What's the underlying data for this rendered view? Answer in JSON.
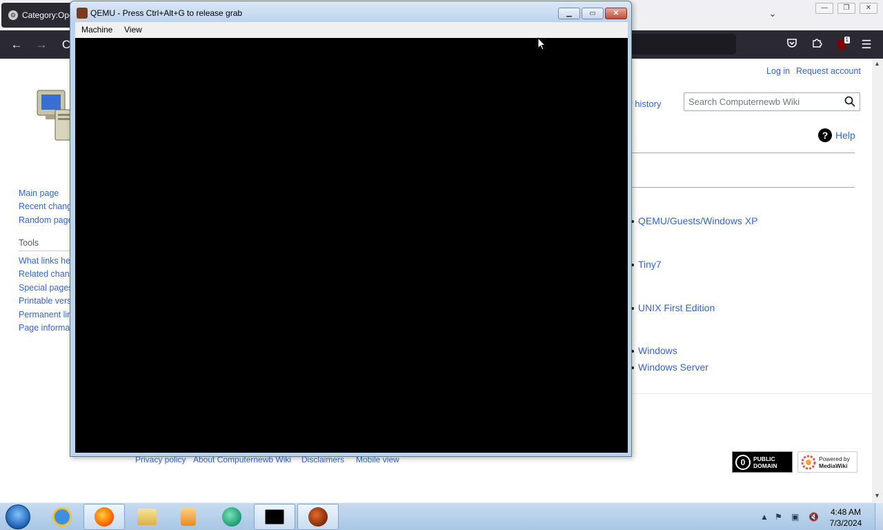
{
  "browser": {
    "tab_title": "Category:Operating",
    "window_controls": {
      "minimize": "—",
      "maximize": "❐",
      "close": "✕"
    },
    "nav": {
      "back": "←",
      "forward": "→",
      "reload": "C"
    },
    "extension_badge": "1"
  },
  "wiki": {
    "personal": {
      "login": "Log in",
      "request_account": "Request account"
    },
    "view_history": "ew history",
    "search_placeholder": "Search Computernewb Wiki",
    "help": "Help",
    "sidebar": {
      "nav": [
        "Main page",
        "Recent changes",
        "Random page"
      ],
      "tools_heading": "Tools",
      "tools": [
        "What links here",
        "Related changes",
        "Special pages",
        "Printable version",
        "Permanent link",
        "Page information"
      ]
    },
    "category_items": [
      "QEMU/Guests/Windows XP",
      "Tiny7",
      "UNIX First Edition",
      "Windows",
      "Windows Server"
    ],
    "footer_links": [
      "Privacy policy",
      "About Computernewb Wiki",
      "Disclaimers",
      "Mobile view"
    ],
    "badges": {
      "public_domain_line1": "PUBLIC",
      "public_domain_line2": "DOMAIN",
      "mediawiki_line1": "Powered by",
      "mediawiki_line2": "MediaWiki"
    }
  },
  "qemu": {
    "title": "QEMU - Press Ctrl+Alt+G to release grab",
    "menu": [
      "Machine",
      "View"
    ]
  },
  "taskbar": {
    "pinned": [
      "internet-explorer",
      "firefox",
      "explorer",
      "media-player",
      "app-green",
      "command-prompt",
      "qemu"
    ],
    "clock_time": "4:48 AM",
    "clock_date": "7/3/2024"
  }
}
